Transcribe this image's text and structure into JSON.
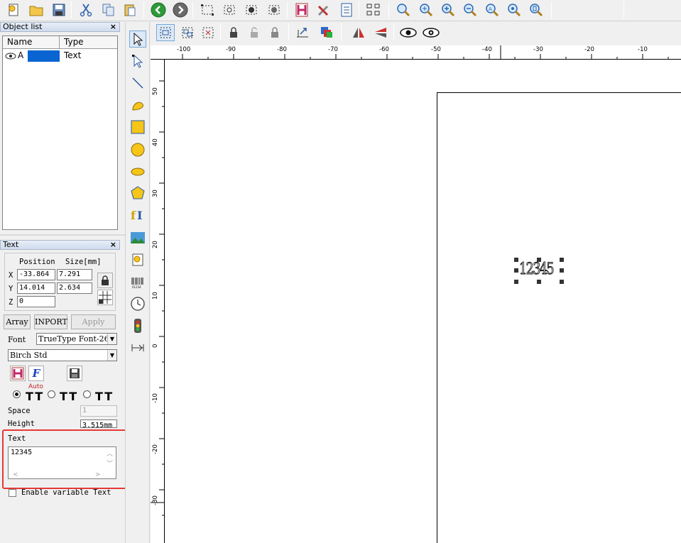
{
  "object_list": {
    "title": "Object list",
    "close": "×",
    "columns": [
      "Name",
      "Type"
    ],
    "rows": [
      {
        "name": "A",
        "type": "Text"
      }
    ]
  },
  "text_panel": {
    "title": "Text",
    "close": "×",
    "position_label": "Position",
    "size_label": "Size[mm]",
    "x_label": "X",
    "y_label": "Y",
    "z_label": "Z",
    "x_pos": "-33.864",
    "x_size": "7.291",
    "y_pos": "14.014",
    "y_size": "2.634",
    "z_pos": "0",
    "array_label": "Array",
    "inport_label": "INPORT",
    "apply_label": "Apply",
    "font_label": "Font",
    "font_type": "TrueType Font-26",
    "font_name": "Birch Std",
    "auto_label": "Auto",
    "space_label": "Space",
    "space_value": "1",
    "height_label": "Height",
    "height_value": "3.515mm",
    "text_label": "Text",
    "text_value": "12345",
    "enable_variable_label": "Enable variable Text"
  },
  "canvas": {
    "object_text": "12345",
    "ruler_h_labels": [
      "-100",
      "-90",
      "-80",
      "-70",
      "-60",
      "-50",
      "-40",
      "-30",
      "-20",
      "-10"
    ],
    "ruler_v_labels": [
      "50",
      "40",
      "30",
      "20",
      "10",
      "0",
      "-10",
      "-20",
      "-30"
    ]
  },
  "colors": {
    "highlight_box": "#e53935",
    "selection_blue": "#0a64d2",
    "panel_bg": "#f0f0f0"
  }
}
